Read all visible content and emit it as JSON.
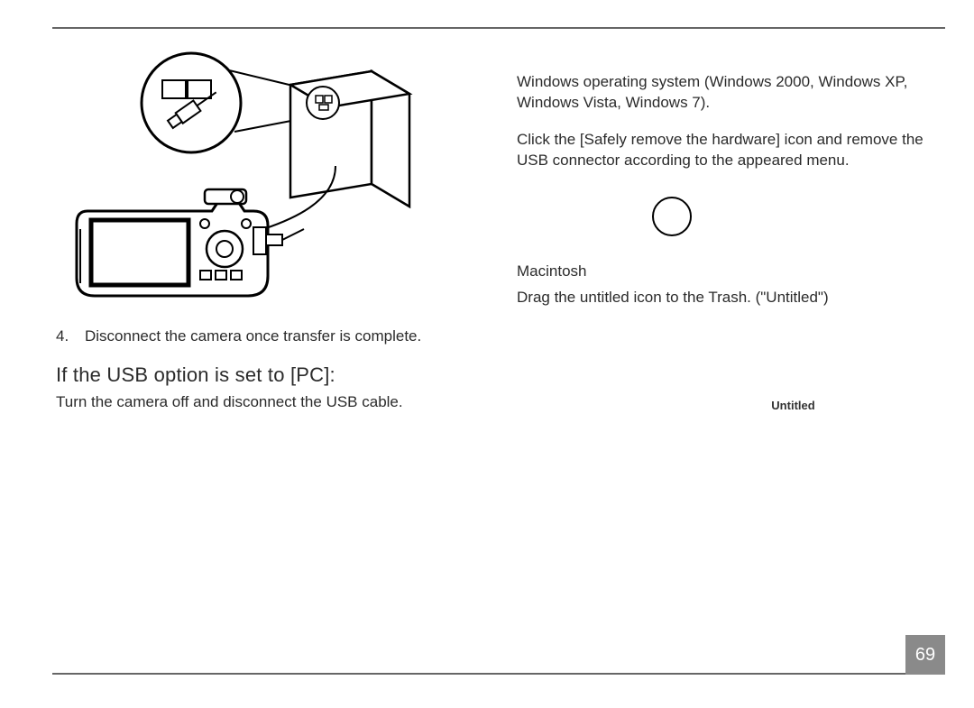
{
  "left": {
    "step_num": "4.",
    "step_text": "Disconnect the camera once transfer is complete.",
    "subhead": "If the USB option is set to [PC]:",
    "subtext": "Turn the camera off and disconnect the USB cable."
  },
  "right": {
    "windows_os": "Windows operating system (Windows 2000, Windows XP, Windows Vista, Windows 7).",
    "windows_instr": "Click the [Safely remove the hardware] icon and remove the USB connector according to the appeared menu.",
    "mac_heading": "Macintosh",
    "mac_instr": "Drag the untitled icon to the Trash. (\"Untitled\")",
    "untitled_label": "Untitled"
  },
  "page_number": "69"
}
